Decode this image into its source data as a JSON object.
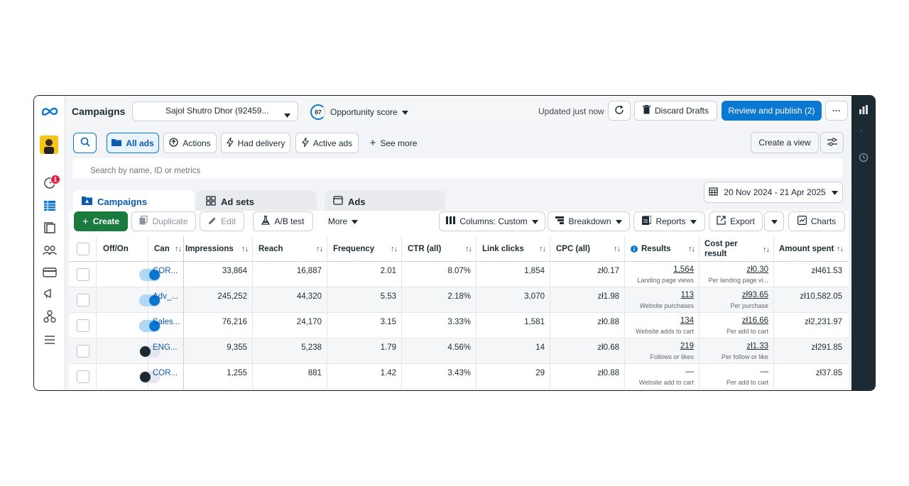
{
  "topbar": {
    "title": "Campaigns",
    "account": "Sajol Shutro Dhor (92459...",
    "opportunity_score": "87",
    "opportunity_label": "Opportunity score",
    "updated": "Updated just now",
    "discard_label": "Discard Drafts",
    "review_label": "Review and publish (2)",
    "more_label": "···"
  },
  "rail": {
    "notification_count": "1"
  },
  "filters": {
    "all_ads": "All ads",
    "actions": "Actions",
    "had_delivery": "Had delivery",
    "active_ads": "Active ads",
    "see_more": "See more",
    "create_view": "Create a view",
    "search_placeholder": "Search by name, ID or metrics"
  },
  "tabs": {
    "campaigns": "Campaigns",
    "ad_sets": "Ad sets",
    "ads": "Ads",
    "date_range": "20 Nov 2024 - 21 Apr 2025"
  },
  "toolbar": {
    "create": "Create",
    "duplicate": "Duplicate",
    "edit": "Edit",
    "ab_test": "A/B test",
    "more": "More",
    "columns": "Columns: Custom",
    "breakdown": "Breakdown",
    "reports": "Reports",
    "export": "Export",
    "charts": "Charts"
  },
  "table": {
    "headers": {
      "offon": "Off/On",
      "campaign": "Can",
      "impressions": "Impressions",
      "reach": "Reach",
      "frequency": "Frequency",
      "ctr": "CTR (all)",
      "link_clicks": "Link clicks",
      "cpc": "CPC (all)",
      "results": "Results",
      "cost_per_result": "Cost per result",
      "amount_spent": "Amount spent"
    },
    "rows": [
      {
        "on": true,
        "campaign": "COR...",
        "impressions": "33,864",
        "reach": "16,887",
        "frequency": "2.01",
        "ctr": "8.07%",
        "link_clicks": "1,854",
        "cpc": "zł0.17",
        "results": "1,564",
        "results_label": "Landing page views",
        "cost": "zł0.30",
        "cost_label": "Per landing page vi...",
        "amount": "zł461.53"
      },
      {
        "on": true,
        "campaign": "Adv_...",
        "impressions": "245,252",
        "reach": "44,320",
        "frequency": "5.53",
        "ctr": "2.18%",
        "link_clicks": "3,070",
        "cpc": "zł1.98",
        "results": "113",
        "results_label": "Website purchases",
        "cost": "zł93.65",
        "cost_label": "Per purchase",
        "amount": "zł10,582.05"
      },
      {
        "on": true,
        "campaign": "Sales...",
        "impressions": "76,216",
        "reach": "24,170",
        "frequency": "3.15",
        "ctr": "3.33%",
        "link_clicks": "1,581",
        "cpc": "zł0.88",
        "results": "134",
        "results_label": "Website adds to cart",
        "cost": "zł16.66",
        "cost_label": "Per add to cart",
        "amount": "zł2,231.97"
      },
      {
        "on": false,
        "campaign": "ENG...",
        "impressions": "9,355",
        "reach": "5,238",
        "frequency": "1.79",
        "ctr": "4.56%",
        "link_clicks": "14",
        "cpc": "zł0.68",
        "results": "219",
        "results_label": "Follows or likes",
        "cost": "zł1.33",
        "cost_label": "Per follow or like",
        "amount": "zł291.85"
      },
      {
        "on": false,
        "campaign": "COR...",
        "impressions": "1,255",
        "reach": "881",
        "frequency": "1.42",
        "ctr": "3.43%",
        "link_clicks": "29",
        "cpc": "zł0.88",
        "results": "—",
        "results_label": "Website add to cart",
        "cost": "—",
        "cost_label": "Per add to cart",
        "amount": "zł37.85"
      }
    ]
  },
  "colors": {
    "accent": "#0a78d1",
    "create_green": "#1b7a3e",
    "rail_dark": "#1c2b33"
  }
}
